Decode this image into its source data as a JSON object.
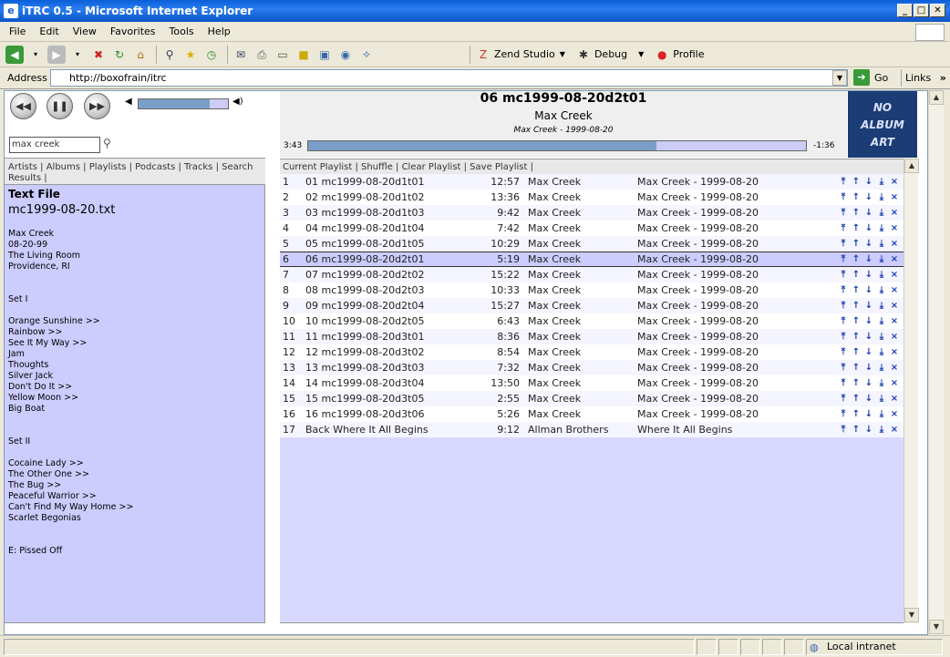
{
  "window": {
    "title": "iTRC 0.5 - Microsoft Internet Explorer",
    "icon": "ie-page-icon"
  },
  "menu": [
    "File",
    "Edit",
    "View",
    "Favorites",
    "Tools",
    "Help"
  ],
  "toolbar": {
    "zend_label": "Zend Studio",
    "debug_label": "Debug",
    "profile_label": "Profile"
  },
  "address": {
    "label": "Address",
    "url": "http://boxofrain/itrc",
    "go_label": "Go",
    "links_label": "Links"
  },
  "status": {
    "zone": "Local intranet"
  },
  "player": {
    "search_value": "max creek",
    "volume_percent": 80
  },
  "nav": {
    "text": "Artists | Albums | Playlists | Podcasts | Tracks | Search Results |"
  },
  "left_panel": {
    "title": "Text File",
    "filename": "mc1999-08-20.txt",
    "lines": [
      "Max Creek",
      "08-20-99",
      "The Living Room",
      "Providence, RI",
      "",
      "",
      "Set I",
      "",
      "Orange Sunshine >>",
      "Rainbow >>",
      "See It My Way >>",
      "Jam",
      "Thoughts",
      "Silver Jack",
      "Don't Do It >>",
      "Yellow Moon >>",
      "Big Boat",
      "",
      "",
      "Set II",
      "",
      "Cocaine Lady >>",
      "The Other One >>",
      "The Bug >>",
      "Peaceful Warrior >>",
      "Can't Find My Way Home >>",
      "Scarlet Begonias",
      "",
      "",
      "E: Pissed Off"
    ]
  },
  "now_playing": {
    "title": "06 mc1999-08-20d2t01",
    "artist": "Max Creek",
    "album": "Max Creek - 1999-08-20",
    "elapsed": "3:43",
    "remaining": "-1:36",
    "progress": 0.7,
    "album_art_text": [
      "NO",
      "ALBUM",
      "ART"
    ]
  },
  "playlist": {
    "header": "Current Playlist | Shuffle | Clear Playlist | Save Playlist |",
    "current_index": 5,
    "rows": [
      {
        "num": "1",
        "title": "01 mc1999-08-20d1t01",
        "length": "12:57",
        "artist": "Max Creek",
        "album": "Max Creek - 1999-08-20"
      },
      {
        "num": "2",
        "title": "02 mc1999-08-20d1t02",
        "length": "13:36",
        "artist": "Max Creek",
        "album": "Max Creek - 1999-08-20"
      },
      {
        "num": "3",
        "title": "03 mc1999-08-20d1t03",
        "length": "9:42",
        "artist": "Max Creek",
        "album": "Max Creek - 1999-08-20"
      },
      {
        "num": "4",
        "title": "04 mc1999-08-20d1t04",
        "length": "7:42",
        "artist": "Max Creek",
        "album": "Max Creek - 1999-08-20"
      },
      {
        "num": "5",
        "title": "05 mc1999-08-20d1t05",
        "length": "10:29",
        "artist": "Max Creek",
        "album": "Max Creek - 1999-08-20"
      },
      {
        "num": "6",
        "title": "06 mc1999-08-20d2t01",
        "length": "5:19",
        "artist": "Max Creek",
        "album": "Max Creek - 1999-08-20"
      },
      {
        "num": "7",
        "title": "07 mc1999-08-20d2t02",
        "length": "15:22",
        "artist": "Max Creek",
        "album": "Max Creek - 1999-08-20"
      },
      {
        "num": "8",
        "title": "08 mc1999-08-20d2t03",
        "length": "10:33",
        "artist": "Max Creek",
        "album": "Max Creek - 1999-08-20"
      },
      {
        "num": "9",
        "title": "09 mc1999-08-20d2t04",
        "length": "15:27",
        "artist": "Max Creek",
        "album": "Max Creek - 1999-08-20"
      },
      {
        "num": "10",
        "title": "10 mc1999-08-20d2t05",
        "length": "6:43",
        "artist": "Max Creek",
        "album": "Max Creek - 1999-08-20"
      },
      {
        "num": "11",
        "title": "11 mc1999-08-20d3t01",
        "length": "8:36",
        "artist": "Max Creek",
        "album": "Max Creek - 1999-08-20"
      },
      {
        "num": "12",
        "title": "12 mc1999-08-20d3t02",
        "length": "8:54",
        "artist": "Max Creek",
        "album": "Max Creek - 1999-08-20"
      },
      {
        "num": "13",
        "title": "13 mc1999-08-20d3t03",
        "length": "7:32",
        "artist": "Max Creek",
        "album": "Max Creek - 1999-08-20"
      },
      {
        "num": "14",
        "title": "14 mc1999-08-20d3t04",
        "length": "13:50",
        "artist": "Max Creek",
        "album": "Max Creek - 1999-08-20"
      },
      {
        "num": "15",
        "title": "15 mc1999-08-20d3t05",
        "length": "2:55",
        "artist": "Max Creek",
        "album": "Max Creek - 1999-08-20"
      },
      {
        "num": "16",
        "title": "16 mc1999-08-20d3t06",
        "length": "5:26",
        "artist": "Max Creek",
        "album": "Max Creek - 1999-08-20"
      },
      {
        "num": "17",
        "title": "Back Where It All Begins",
        "length": "9:12",
        "artist": "Allman Brothers",
        "album": "Where It All Begins"
      }
    ]
  },
  "colors": {
    "accent": "#7b9ec8",
    "panel": "#ccccff",
    "album_art_bg": "#1b3c74"
  }
}
